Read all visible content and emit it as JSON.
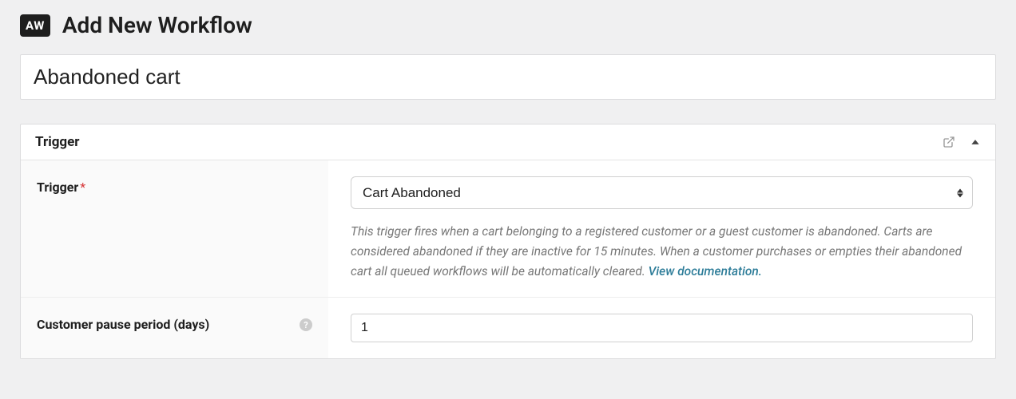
{
  "header": {
    "badge": "AW",
    "title": "Add New Workflow"
  },
  "workflow_title": "Abandoned cart",
  "panel": {
    "title": "Trigger",
    "fields": {
      "trigger": {
        "label": "Trigger",
        "required_mark": "*",
        "selected": "Cart Abandoned",
        "description": "This trigger fires when a cart belonging to a registered customer or a guest customer is abandoned. Carts are considered abandoned if they are inactive for 15 minutes. When a customer purchases or empties their abandoned cart all queued workflows will be automatically cleared. ",
        "doc_link": "View documentation."
      },
      "pause": {
        "label": "Customer pause period (days)",
        "help": "?",
        "value": "1"
      }
    }
  }
}
